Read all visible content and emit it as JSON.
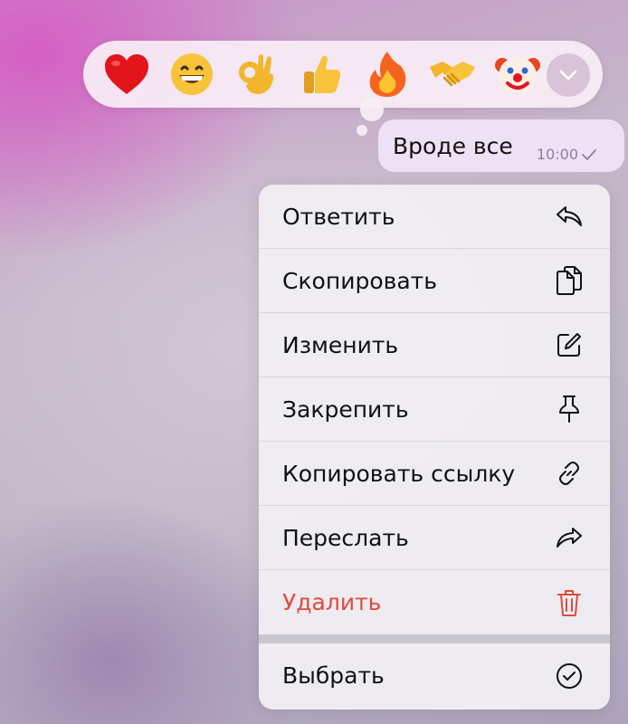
{
  "reactions": [
    {
      "icon": "red-heart-emoji",
      "glyph": "❤️"
    },
    {
      "icon": "grinning-face-emoji",
      "glyph": "😁"
    },
    {
      "icon": "ok-hand-emoji",
      "glyph": "👌"
    },
    {
      "icon": "thumbs-up-emoji",
      "glyph": "👍"
    },
    {
      "icon": "fire-emoji",
      "glyph": "🔥"
    },
    {
      "icon": "handshake-emoji",
      "glyph": "🤝"
    },
    {
      "icon": "clown-face-emoji",
      "glyph": "🤡"
    }
  ],
  "reactions_more_icon": "chevron-down-icon",
  "message": {
    "text": "Вроде все",
    "time": "10:00",
    "status_icon": "checkmark-icon"
  },
  "menu": {
    "items": [
      {
        "label": "Ответить",
        "icon": "reply-icon"
      },
      {
        "label": "Скопировать",
        "icon": "copy-icon"
      },
      {
        "label": "Изменить",
        "icon": "edit-icon"
      },
      {
        "label": "Закрепить",
        "icon": "pin-icon"
      },
      {
        "label": "Копировать ссылку",
        "icon": "link-icon"
      },
      {
        "label": "Переслать",
        "icon": "forward-icon"
      },
      {
        "label": "Удалить",
        "icon": "trash-icon",
        "color": "#e2493c"
      }
    ],
    "select_item": {
      "label": "Выбрать",
      "icon": "checkmark-circle-icon"
    }
  },
  "colors": {
    "accent_danger": "#e2493c",
    "bubble": "#efe1f5",
    "meta_text": "#8d7d9e"
  }
}
